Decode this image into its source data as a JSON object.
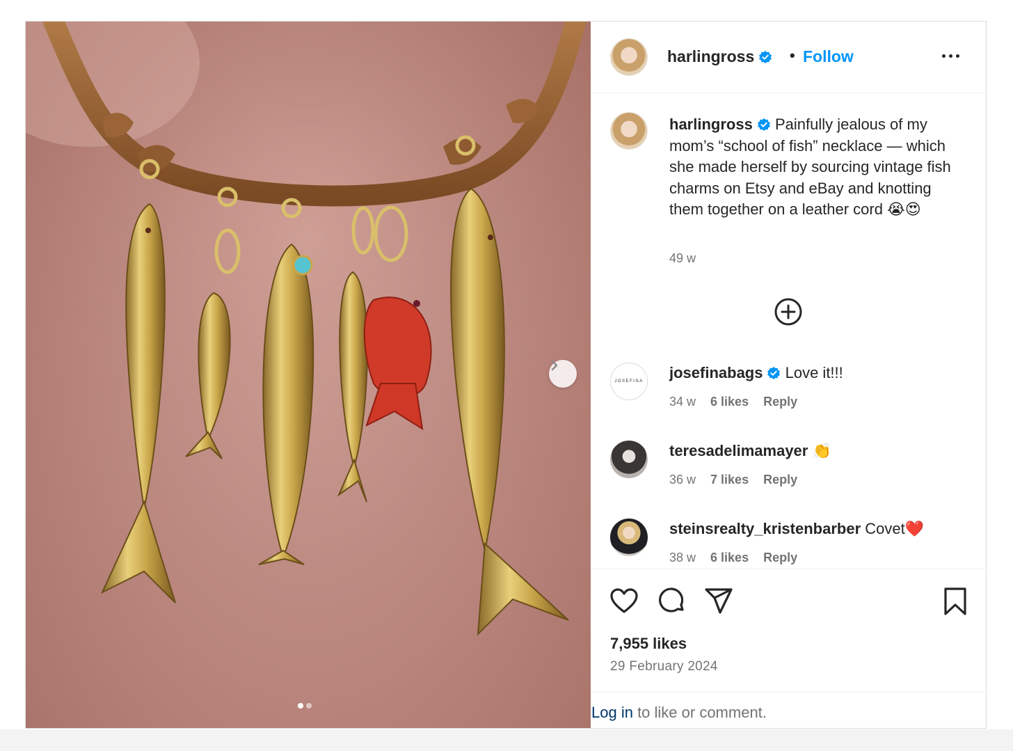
{
  "header": {
    "username": "harlingross",
    "follow_label": "Follow"
  },
  "caption": {
    "username": "harlingross",
    "text": "Painfully jealous of my mom’s “school of fish” necklace — which she made herself by sourcing vintage fish charms on Etsy and eBay and knotting them together on a leather cord 😭😍",
    "time": "49 w"
  },
  "comments": [
    {
      "username": "josefinabags",
      "verified": true,
      "text": "Love it!!!",
      "time": "34 w",
      "likes": "6 likes",
      "reply": "Reply",
      "avatar_text": "JOSEFINA"
    },
    {
      "username": "teresadelimamayer",
      "verified": false,
      "text": "👏",
      "time": "36 w",
      "likes": "7 likes",
      "reply": "Reply"
    },
    {
      "username": "steinsrealty_kristenbarber",
      "verified": false,
      "text": "Covet❤️",
      "time": "38 w",
      "likes": "6 likes",
      "reply": "Reply"
    }
  ],
  "stats": {
    "likes": "7,955 likes",
    "date": "29 February 2024"
  },
  "login": {
    "link": "Log in",
    "rest": " to like or comment."
  },
  "carousel": {
    "slide_count": 2,
    "current": 1
  },
  "colors": {
    "accent": "#0095f6",
    "link_dark": "#00376b",
    "muted": "#737373",
    "text": "#262626"
  },
  "icons": [
    "verified-badge-icon",
    "more-options-icon",
    "add-circle-icon",
    "heart-icon",
    "comment-icon",
    "share-icon",
    "bookmark-icon",
    "chevron-right-icon"
  ]
}
